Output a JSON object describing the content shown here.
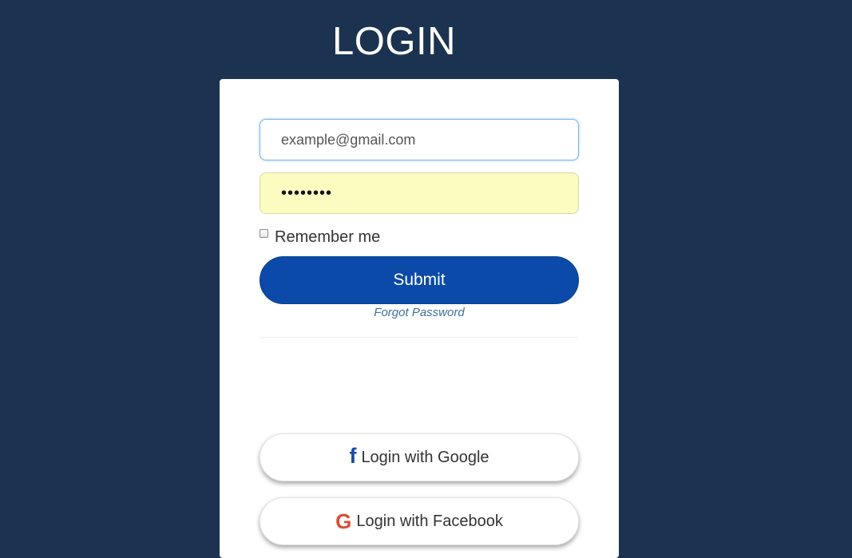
{
  "header": {
    "title": "LOGIN"
  },
  "form": {
    "email_value": "example@gmail.com",
    "password_value": "••••••••",
    "remember_label": "Remember me",
    "remember_checked": false,
    "submit_label": "Submit",
    "forgot_label": "Forgot Password"
  },
  "social": {
    "google_button": {
      "icon": "facebook-f-icon",
      "icon_glyph": "f",
      "label": "Login with Google"
    },
    "facebook_button": {
      "icon": "google-g-icon",
      "icon_glyph": "G",
      "label": "Login with Facebook"
    }
  },
  "colors": {
    "background": "#1b3350",
    "card": "#ffffff",
    "submit": "#0b4aa8",
    "autofill": "#fafdbf",
    "link": "#3d6fa0",
    "facebook_blue": "#1d4aa0",
    "google_red": "#dd4b39"
  }
}
